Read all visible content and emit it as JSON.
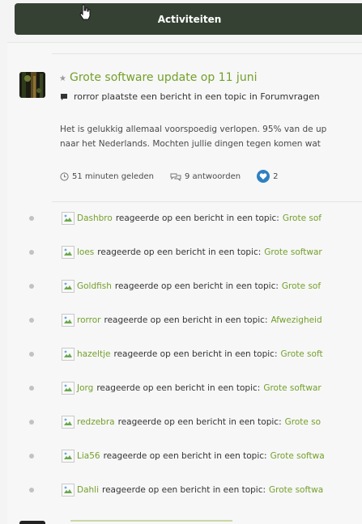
{
  "header": {
    "tab_label": "Activiteiten"
  },
  "post": {
    "title": "Grote software update op 11 juni",
    "meta": "rorror plaatste een bericht in een topic in Forumvragen",
    "excerpt_line1": "Het is gelukkig allemaal voorspoedig verlopen. 95% van de up",
    "excerpt_line2": "naar het Nederlands. Mochten jullie dingen tegen komen wat",
    "time": "51 minuten geleden",
    "replies": "9 antwoorden",
    "likes": "2"
  },
  "activities": [
    {
      "user": "Dashbro",
      "text": "reageerde op een bericht in een topic:",
      "topic": "Grote sof"
    },
    {
      "user": "loes",
      "text": "reageerde op een bericht in een topic:",
      "topic": "Grote softwar"
    },
    {
      "user": "Goldfish",
      "text": "reageerde op een bericht in een topic:",
      "topic": "Grote sof"
    },
    {
      "user": "rorror",
      "text": "reageerde op een bericht in een topic:",
      "topic": "Afwezigheid"
    },
    {
      "user": "hazeltje",
      "text": "reageerde op een bericht in een topic:",
      "topic": "Grote soft"
    },
    {
      "user": "Jorg",
      "text": "reageerde op een bericht in een topic:",
      "topic": "Grote softwar"
    },
    {
      "user": "redzebra",
      "text": "reageerde op een bericht in een topic:",
      "topic": "Grote so"
    },
    {
      "user": "Lia56",
      "text": "reageerde op een bericht in een topic:",
      "topic": "Grote softwa"
    },
    {
      "user": "Dahli",
      "text": "reageerde op een bericht in een topic:",
      "topic": "Grote softwa"
    }
  ],
  "colors": {
    "tab_background": "#354233",
    "accent_green": "#73a02b",
    "like_blue": "#2f7fc1"
  }
}
